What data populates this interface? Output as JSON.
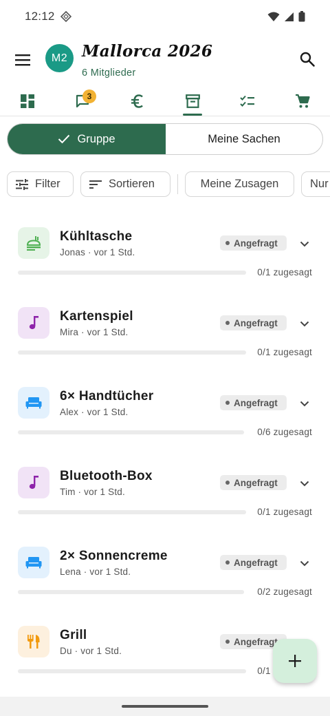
{
  "status_bar": {
    "time": "12:12"
  },
  "header": {
    "avatar": "M2",
    "title": "Mallorca 2026",
    "subtitle": "6 Mitglieder"
  },
  "tabs": [
    {
      "icon": "dashboard-icon"
    },
    {
      "icon": "chat-icon",
      "badge": "3"
    },
    {
      "icon": "euro-icon"
    },
    {
      "icon": "inventory-icon",
      "active": true
    },
    {
      "icon": "checklist-icon"
    },
    {
      "icon": "cart-icon"
    }
  ],
  "segmented": {
    "active": "Gruppe",
    "inactive": "Meine Sachen"
  },
  "chips": [
    "Filter",
    "Sortieren",
    "Meine Zusagen",
    "Nur"
  ],
  "items": [
    {
      "name": "Kühltasche",
      "meta": "Jonas · vor 1 Std.",
      "status": "Angefragt",
      "progress": "0/1 zugesagt",
      "committed": 0,
      "total": 1,
      "icon": "food-icon",
      "icon_color": "#4caf50",
      "icon_bg": "#e6f4e7"
    },
    {
      "name": "Kartenspiel",
      "meta": "Mira · vor 1 Std.",
      "status": "Angefragt",
      "progress": "0/1 zugesagt",
      "committed": 0,
      "total": 1,
      "icon": "music-note-icon",
      "icon_color": "#8e24aa",
      "icon_bg": "#f1e3f6"
    },
    {
      "name": "6× Handtücher",
      "meta": "Alex · vor 1 Std.",
      "status": "Angefragt",
      "progress": "0/6 zugesagt",
      "committed": 0,
      "total": 6,
      "icon": "sofa-icon",
      "icon_color": "#2196f3",
      "icon_bg": "#e3f1fd"
    },
    {
      "name": "Bluetooth-Box",
      "meta": "Tim · vor 1 Std.",
      "status": "Angefragt",
      "progress": "0/1 zugesagt",
      "committed": 0,
      "total": 1,
      "icon": "music-note-icon",
      "icon_color": "#8e24aa",
      "icon_bg": "#f1e3f6"
    },
    {
      "name": "2× Sonnencreme",
      "meta": "Lena · vor 1 Std.",
      "status": "Angefragt",
      "progress": "0/2 zugesagt",
      "committed": 0,
      "total": 2,
      "icon": "sofa-icon",
      "icon_color": "#2196f3",
      "icon_bg": "#e3f1fd"
    },
    {
      "name": "Grill",
      "meta": "Du · vor 1 Std.",
      "status": "Angefragt",
      "progress": "0/1 zugesagt",
      "committed": 0,
      "total": 1,
      "icon": "cutlery-icon",
      "icon_color": "#f29a0f",
      "icon_bg": "#fdf0de"
    }
  ],
  "colors": {
    "primary": "#2d6b4e",
    "avatar": "#1a9a86",
    "badge": "#f2b233",
    "fab": "#d4efdc"
  }
}
